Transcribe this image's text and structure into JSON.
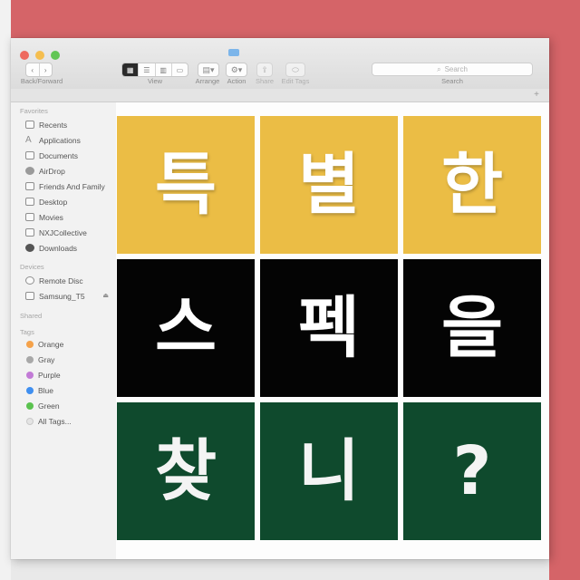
{
  "toolbar": {
    "back_forward_label": "Back/Forward",
    "view_label": "View",
    "arrange_label": "Arrange",
    "action_label": "Action",
    "share_label": "Share",
    "edit_tags_label": "Edit Tags",
    "search_label": "Search",
    "search_placeholder": "Search"
  },
  "sidebar": {
    "favorites_heading": "Favorites",
    "favorites": [
      {
        "label": "Recents",
        "icon": "clock-icon"
      },
      {
        "label": "Applications",
        "icon": "applications-icon"
      },
      {
        "label": "Documents",
        "icon": "documents-icon"
      },
      {
        "label": "AirDrop",
        "icon": "airdrop-icon"
      },
      {
        "label": "Friends And Family",
        "icon": "folder-icon"
      },
      {
        "label": "Desktop",
        "icon": "desktop-icon"
      },
      {
        "label": "Movies",
        "icon": "movies-icon"
      },
      {
        "label": "NXJCollective",
        "icon": "folder-icon"
      },
      {
        "label": "Downloads",
        "icon": "downloads-icon"
      }
    ],
    "devices_heading": "Devices",
    "devices": [
      {
        "label": "Remote Disc",
        "icon": "disc-icon"
      },
      {
        "label": "Samsung_T5",
        "icon": "drive-icon"
      }
    ],
    "shared_heading": "Shared",
    "tags_heading": "Tags",
    "tags": [
      {
        "label": "Orange",
        "color": "#f5a24a"
      },
      {
        "label": "Gray",
        "color": "#a8a8a8"
      },
      {
        "label": "Purple",
        "color": "#c27bd6"
      },
      {
        "label": "Blue",
        "color": "#3f8ff0"
      },
      {
        "label": "Green",
        "color": "#5ac24f"
      },
      {
        "label": "All Tags...",
        "color": "#e4e4e4"
      }
    ]
  },
  "tiles": [
    {
      "char": "특",
      "bg": "yellow"
    },
    {
      "char": "별",
      "bg": "yellow"
    },
    {
      "char": "한",
      "bg": "yellow"
    },
    {
      "char": "스",
      "bg": "black"
    },
    {
      "char": "펙",
      "bg": "black"
    },
    {
      "char": "을",
      "bg": "black"
    },
    {
      "char": "찾",
      "bg": "green"
    },
    {
      "char": "니",
      "bg": "green"
    },
    {
      "char": "?",
      "bg": "green"
    }
  ],
  "colors": {
    "background": "#d56468",
    "tile_yellow": "#ebbd45",
    "tile_black": "#040404",
    "tile_green": "#0f4a2d"
  }
}
